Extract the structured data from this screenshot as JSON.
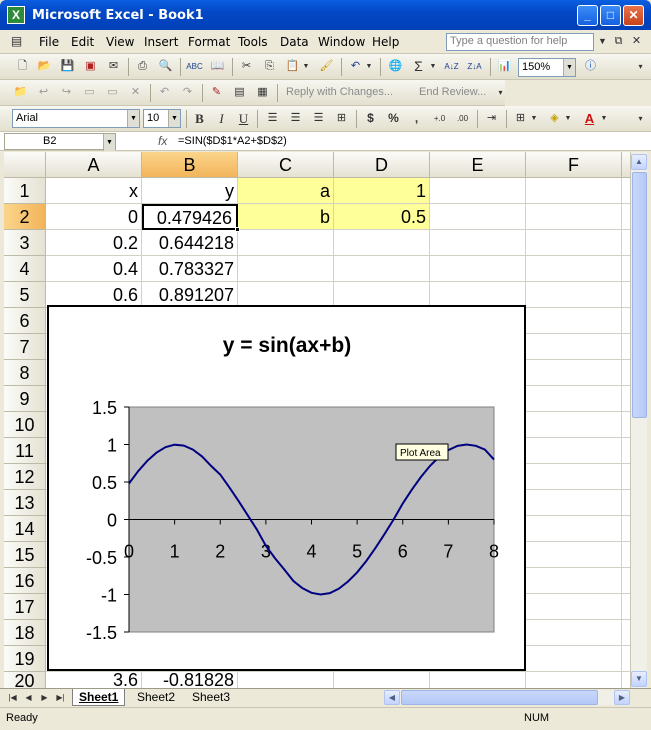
{
  "window": {
    "title": "Microsoft Excel - Book1",
    "app_icon": "X"
  },
  "menu": [
    "File",
    "Edit",
    "View",
    "Insert",
    "Format",
    "Tools",
    "Data",
    "Window",
    "Help"
  ],
  "help_box": {
    "placeholder": "Type a question for help"
  },
  "toolbar": {
    "font": "Arial",
    "size": "10",
    "zoom": "150%",
    "reply_with_changes": "Reply with Changes...",
    "end_review": "End Review...",
    "bold": "B",
    "italic": "I",
    "underline": "U",
    "currency": "$",
    "percent": "%",
    "comma": ",",
    "sigma": "Σ"
  },
  "formula_bar": {
    "name_box": "B2",
    "fx": "fx",
    "formula": "=SIN($D$1*A2+$D$2)"
  },
  "columns": [
    "A",
    "B",
    "C",
    "D",
    "E",
    "F"
  ],
  "rows": [
    "1",
    "2",
    "3",
    "4",
    "5",
    "6",
    "7",
    "8",
    "9",
    "10",
    "11",
    "12",
    "13",
    "14",
    "15",
    "16",
    "17",
    "18",
    "19",
    "20"
  ],
  "cells": {
    "A1": "x",
    "B1": "y",
    "C1": "a",
    "D1": "1",
    "A2": "0",
    "B2": "0.479426",
    "C2": "b",
    "D2": "0.5",
    "A3": "0.2",
    "B3": "0.644218",
    "A4": "0.4",
    "B4": "0.783327",
    "A5": "0.6",
    "B5": "0.891207",
    "A20": "3.6",
    "B20": "-0.81828"
  },
  "chart_data": {
    "type": "scatter",
    "title": "y = sin(ax+b)",
    "xlabel": "",
    "ylabel": "",
    "xlim": [
      0,
      8
    ],
    "ylim": [
      -1.5,
      1.5
    ],
    "x_ticks": [
      "0",
      "1",
      "2",
      "3",
      "4",
      "5",
      "6",
      "7",
      "8"
    ],
    "y_ticks": [
      "1.5",
      "1",
      "0.5",
      "0",
      "-0.5",
      "-1",
      "-1.5"
    ],
    "series": [
      {
        "x": [
          0,
          0.2,
          0.4,
          0.6,
          0.8,
          1.0,
          1.2,
          1.4,
          1.6,
          1.8,
          2.0,
          2.2,
          2.4,
          2.6,
          2.8,
          3.0,
          3.2,
          3.4,
          3.6,
          3.8,
          4.0,
          4.2,
          4.4,
          4.6,
          4.8,
          5.0,
          5.2,
          5.4,
          5.6,
          5.8,
          6.0,
          6.2,
          6.4,
          6.6,
          6.8,
          7.0,
          7.2,
          7.4,
          7.6,
          7.8,
          8.0
        ],
        "y": [
          0.479426,
          0.644218,
          0.783327,
          0.891207,
          0.963558,
          0.997495,
          0.98545,
          0.932039,
          0.841471,
          0.714112,
          0.598472,
          0.42738,
          0.247404,
          0.058374,
          -0.132352,
          -0.350783,
          -0.515501,
          -0.662969,
          -0.81828,
          -0.915697,
          -0.97753,
          -0.999643,
          -0.98089,
          -0.922604,
          -0.826366,
          -0.70554,
          -0.552835,
          -0.380779,
          -0.194831,
          0.0,
          0.21512,
          0.398609,
          0.568057,
          0.715613,
          0.836026,
          0.925212,
          0.980936,
          1.0,
          0.983268,
          0.932039,
          0.798487
        ]
      }
    ],
    "plot_bg": "#C0C0C0",
    "line_color": "#000080",
    "tooltip": "Plot Area"
  },
  "sheets": [
    "Sheet1",
    "Sheet2",
    "Sheet3"
  ],
  "status": {
    "left": "Ready",
    "num": "NUM"
  }
}
